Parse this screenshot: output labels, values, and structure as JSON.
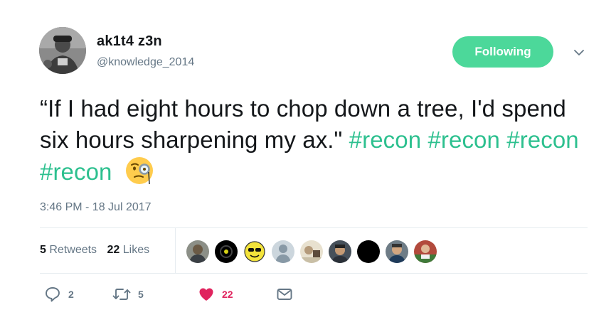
{
  "user": {
    "name": "ak1t4 z3n",
    "handle": "@knowledge_2014"
  },
  "follow_button": {
    "label": "Following",
    "color": "#4cd89a"
  },
  "tweet": {
    "text_main": "“If I had eight hours to chop down a tree, I'd spend six hours sharpening my ax.\"",
    "hashtags": [
      "#recon",
      "#recon",
      "#recon",
      "#recon"
    ],
    "emoji": "face-with-monocle",
    "hashtag_color": "#2dc08f"
  },
  "timestamp": "3:46 PM - 18 Jul 2017",
  "stats": {
    "retweets_count": "5",
    "retweets_label": "Retweets",
    "likes_count": "22",
    "likes_label": "Likes"
  },
  "likers": [
    {
      "name": "liker-1"
    },
    {
      "name": "liker-2"
    },
    {
      "name": "liker-3"
    },
    {
      "name": "liker-4"
    },
    {
      "name": "liker-5"
    },
    {
      "name": "liker-6"
    },
    {
      "name": "liker-7"
    },
    {
      "name": "liker-8"
    },
    {
      "name": "liker-9"
    }
  ],
  "actions": {
    "reply_count": "2",
    "retweet_count": "5",
    "like_count": "22",
    "like_color": "#e0245e"
  },
  "icons": {
    "reply": "reply-icon",
    "retweet": "retweet-icon",
    "like": "heart-icon",
    "dm": "envelope-icon",
    "caret": "chevron-down-icon"
  }
}
